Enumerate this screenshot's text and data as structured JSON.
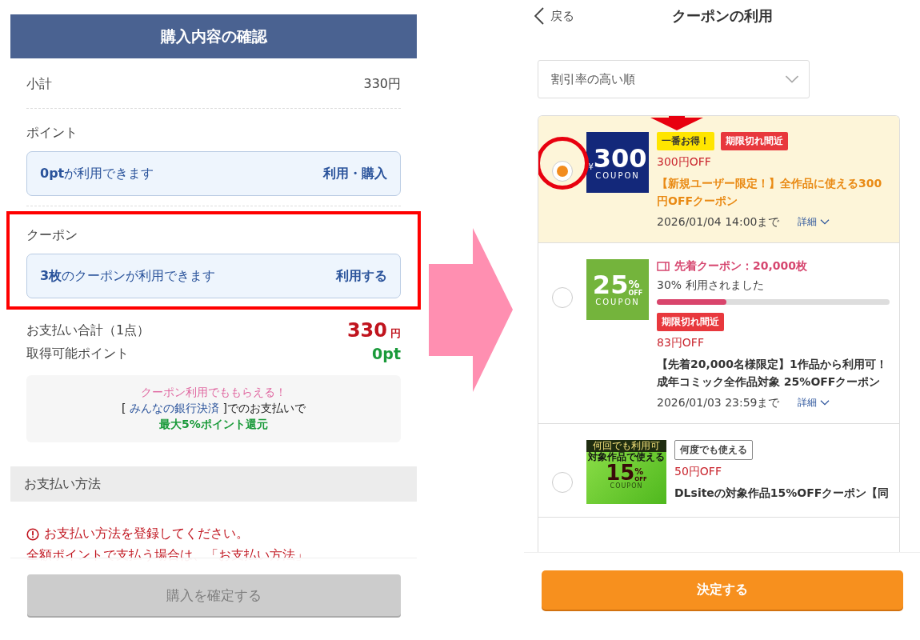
{
  "left": {
    "title": "購入内容の確認",
    "subtotal": {
      "label": "小計",
      "value": "330円"
    },
    "points": {
      "label": "ポイント",
      "text": "**0pt**が利用できます",
      "action": "利用・購入"
    },
    "coupon": {
      "label": "クーポン",
      "text": "**3枚**のクーポンが利用できます",
      "action": "利用する"
    },
    "total": {
      "label": "お支払い合計（1点）",
      "amount": "330",
      "unit": "円"
    },
    "earn": {
      "label": "取得可能ポイント",
      "value": "0pt"
    },
    "promo": {
      "headline": "クーポン利用でももらえる！",
      "prefix": "[ ",
      "link": "みんなの銀行決済",
      "suffix": " ]でのお支払いで",
      "reward": "最大5%ポイント還元"
    },
    "payment": {
      "heading": "お支払い方法",
      "error": "お支払い方法を登録してください。",
      "note": "全額ポイントで支払う場合は、「お支払い方法」"
    },
    "confirm": {
      "label": "購入を確定する",
      "disabled": true
    }
  },
  "right": {
    "back": "戻る",
    "title": "クーポンの利用",
    "sort": "割引率の高い順",
    "coupons": [
      {
        "selected": true,
        "image": {
          "kind": "amount",
          "currency": "¥",
          "value": "300",
          "label": "COUPON"
        },
        "tags": [
          {
            "kind": "best",
            "text": "一番お得！"
          },
          {
            "kind": "expiring",
            "text": "期限切れ間近"
          }
        ],
        "discount": "300円OFF",
        "title": "【新規ユーザー限定！】全作品に使える300円OFFクーポン",
        "highlight": true,
        "expires": "2026/01/04 14:00まで",
        "details": "詳細"
      },
      {
        "selected": false,
        "image": {
          "kind": "percent",
          "value": "25",
          "percent": "%",
          "off": "OFF",
          "label": "COUPON"
        },
        "stock": {
          "text": "先着クーポン：20,000枚",
          "usage": "30% 利用されました",
          "level": 0.3
        },
        "tags": [
          {
            "kind": "expiring",
            "text": "期限切れ間近"
          }
        ],
        "discount": "83円OFF",
        "title": "【先着20,000名様限定】1作品から利用可！成年コミック全作品対象 25%OFFクーポン",
        "highlight": false,
        "expires": "2026/01/03 23:59まで",
        "details": "詳細"
      },
      {
        "selected": false,
        "image": {
          "kind": "reusable",
          "banner": "何回でも利用可",
          "caption": "対象作品で使える",
          "value": "15",
          "percent": "%",
          "off": "OFF",
          "label": "COUPON"
        },
        "tags": [
          {
            "kind": "reusable",
            "text": "何度でも使える"
          }
        ],
        "discount": "50円OFF",
        "title": "DLsiteの対象作品15%OFFクーポン【同",
        "highlight": false
      }
    ],
    "submit": "決定する"
  }
}
